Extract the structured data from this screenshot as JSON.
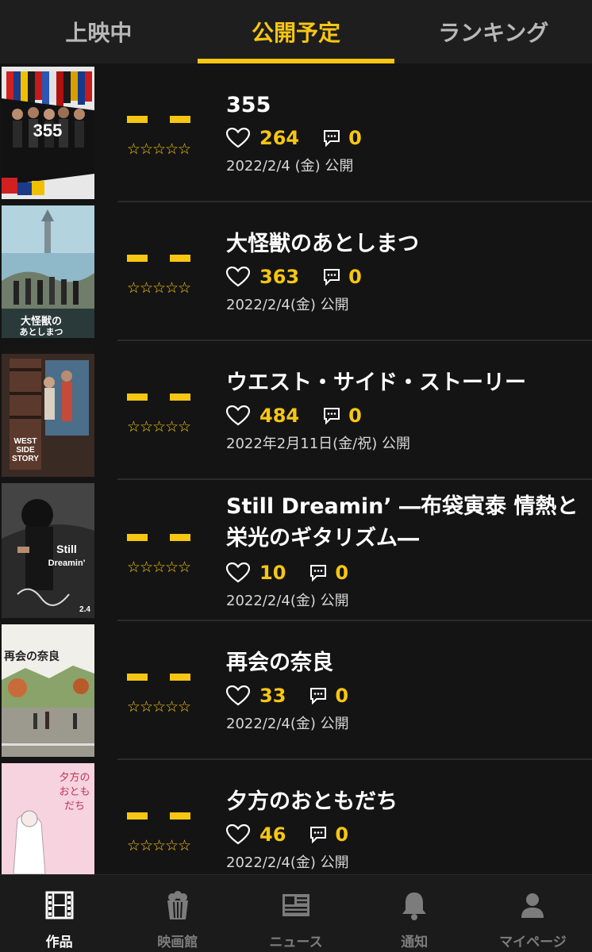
{
  "tabs": [
    {
      "label": "上映中",
      "active": false
    },
    {
      "label": "公開予定",
      "active": true
    },
    {
      "label": "ランキング",
      "active": false
    }
  ],
  "accent_color": "#f7c613",
  "movies": [
    {
      "title": "355",
      "likes": "264",
      "comments": "0",
      "release": "2022/2/4 (金) 公開",
      "stars": "☆☆☆☆☆"
    },
    {
      "title": "大怪獣のあとしまつ",
      "likes": "363",
      "comments": "0",
      "release": "2022/2/4(金) 公開",
      "stars": "☆☆☆☆☆"
    },
    {
      "title": "ウエスト・サイド・ストーリー",
      "likes": "484",
      "comments": "0",
      "release": "2022年2月11日(金/祝) 公開",
      "stars": "☆☆☆☆☆"
    },
    {
      "title": "Still Dreamin’ ―布袋寅泰 情熱と栄光のギタリズム―",
      "likes": "10",
      "comments": "0",
      "release": "2022/2/4(金) 公開",
      "stars": "☆☆☆☆☆"
    },
    {
      "title": "再会の奈良",
      "likes": "33",
      "comments": "0",
      "release": "2022/2/4(金) 公開",
      "stars": "☆☆☆☆☆"
    },
    {
      "title": "夕方のおともだち",
      "likes": "46",
      "comments": "0",
      "release": "2022/2/4(金) 公開",
      "stars": "☆☆☆☆☆"
    }
  ],
  "bottom_nav": [
    {
      "label": "作品",
      "icon": "film-icon",
      "active": true
    },
    {
      "label": "映画館",
      "icon": "popcorn-icon",
      "active": false
    },
    {
      "label": "ニュース",
      "icon": "newspaper-icon",
      "active": false
    },
    {
      "label": "通知",
      "icon": "bell-icon",
      "active": false
    },
    {
      "label": "マイページ",
      "icon": "person-icon",
      "active": false
    }
  ]
}
